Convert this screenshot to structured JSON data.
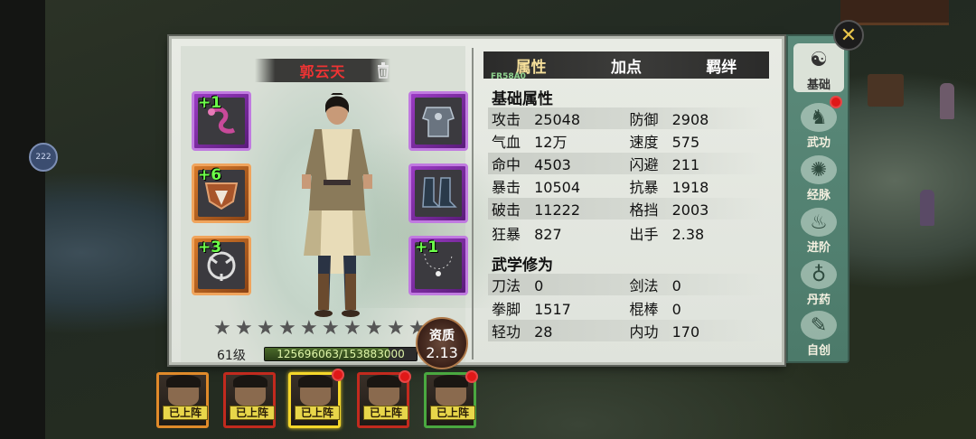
{
  "character": {
    "name": "郭云天",
    "level": "61级",
    "exp_text": "125696063/153883000",
    "exp_fraction": 0.817,
    "stars_total": 10,
    "stars_filled": 0,
    "aptitude_label": "资质",
    "aptitude_value": "2.13"
  },
  "equipment": [
    {
      "slot": "left-1",
      "plus": "+1",
      "rarity": "purple",
      "icon": "snake-whip-icon"
    },
    {
      "slot": "left-2",
      "plus": "+6",
      "rarity": "orange",
      "icon": "chest-armor-icon"
    },
    {
      "slot": "left-3",
      "plus": "+3",
      "rarity": "orange",
      "icon": "ring-blade-icon"
    },
    {
      "slot": "right-1",
      "plus": "",
      "rarity": "purple",
      "icon": "robe-armor-icon"
    },
    {
      "slot": "right-2",
      "plus": "",
      "rarity": "purple",
      "icon": "boots-icon"
    },
    {
      "slot": "right-3",
      "plus": "+1",
      "rarity": "purple",
      "icon": "bead-necklace-icon"
    }
  ],
  "tabs": [
    {
      "label": "属性",
      "active": true
    },
    {
      "label": "加点",
      "active": false
    },
    {
      "label": "羁绊",
      "active": false
    }
  ],
  "tab_sub_label": "FR58A0",
  "basic_title": "基础属性",
  "basic_stats": [
    [
      {
        "k": "攻击",
        "v": "25048"
      },
      {
        "k": "防御",
        "v": "2908"
      }
    ],
    [
      {
        "k": "气血",
        "v": "12万"
      },
      {
        "k": "速度",
        "v": "575"
      }
    ],
    [
      {
        "k": "命中",
        "v": "4503"
      },
      {
        "k": "闪避",
        "v": "211"
      }
    ],
    [
      {
        "k": "暴击",
        "v": "10504"
      },
      {
        "k": "抗暴",
        "v": "1918"
      }
    ],
    [
      {
        "k": "破击",
        "v": "11222"
      },
      {
        "k": "格挡",
        "v": "2003"
      }
    ],
    [
      {
        "k": "狂暴",
        "v": "827"
      },
      {
        "k": "出手",
        "v": "2.38"
      }
    ]
  ],
  "martial_title": "武学修为",
  "martial_stats": [
    [
      {
        "k": "刀法",
        "v": "0"
      },
      {
        "k": "剑法",
        "v": "0"
      }
    ],
    [
      {
        "k": "拳脚",
        "v": "1517"
      },
      {
        "k": "棍棒",
        "v": "0"
      }
    ],
    [
      {
        "k": "轻功",
        "v": "28"
      },
      {
        "k": "内功",
        "v": "170"
      }
    ]
  ],
  "side_menu": [
    {
      "label": "基础",
      "icon": "scholar-icon",
      "active": true,
      "badge": true
    },
    {
      "label": "武功",
      "icon": "martial-pose-icon",
      "active": false,
      "badge": false
    },
    {
      "label": "经脉",
      "icon": "meridian-swirl-icon",
      "active": false,
      "badge": false
    },
    {
      "label": "进阶",
      "icon": "flame-icon",
      "active": false,
      "badge": false
    },
    {
      "label": "丹药",
      "icon": "gourd-icon",
      "active": false,
      "badge": false
    },
    {
      "label": "自创",
      "icon": "book-icon",
      "active": false,
      "badge": false
    }
  ],
  "team": [
    {
      "tag": "已上阵",
      "border": "orange",
      "selected": false,
      "badge": false
    },
    {
      "tag": "已上阵",
      "border": "red",
      "selected": false,
      "badge": false
    },
    {
      "tag": "已上阵",
      "border": "red",
      "selected": true,
      "badge": true
    },
    {
      "tag": "已上阵",
      "border": "red",
      "selected": false,
      "badge": true
    },
    {
      "tag": "已上阵",
      "border": "green",
      "selected": false,
      "badge": true
    }
  ],
  "left_circle_label": "222",
  "colors": {
    "panel_bg": "#e3e6df",
    "side_menu": "#5b8a7a",
    "name_red": "#ee3333",
    "plus_green": "#6cff4a",
    "badge_red": "#e01818"
  }
}
